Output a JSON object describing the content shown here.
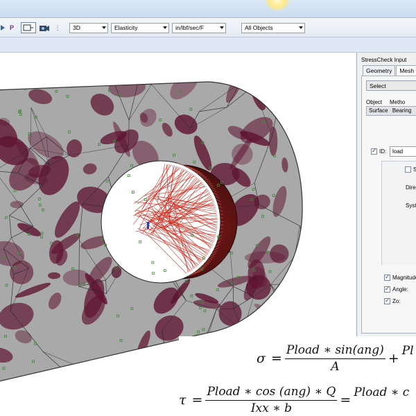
{
  "toolbar": {
    "combos": [
      {
        "value": "3D"
      },
      {
        "value": "Elasticity"
      },
      {
        "value": "in/lbf/sec/F"
      },
      {
        "value": "All Objects"
      }
    ],
    "icons": [
      "arrow-icon",
      "pointer-p-icon",
      "window-select-icon",
      "camera-icon"
    ],
    "p_label": "P"
  },
  "panel": {
    "title": "StressCheck Input",
    "tabs": [
      "Geometry",
      "Mesh"
    ],
    "action_select": "Select",
    "object_label": "Object",
    "method_label": "Metho",
    "object_value": "Surface",
    "method_value": "Bearing",
    "id_label": "ID:",
    "id_value": "load",
    "s_label": "S",
    "direction_label": "Direc",
    "system_label": "Syste",
    "magnitude_label": "Magnitude",
    "angle_label": "Angle:",
    "zo_label": "Zo:"
  },
  "formula": {
    "eq1": {
      "lhs": "σ",
      "eq": "=",
      "num": "Pload ∗ sin(ang)",
      "den": "A",
      "plus": "+",
      "tail": "Pl"
    },
    "eq2": {
      "lhs": "τ",
      "eq": "=",
      "num": "Pload ∗ cos (ang) ∗ Q",
      "den": "Ixx ∗ b",
      "eq_b": "=",
      "tail": "Pload ∗ c"
    }
  },
  "colors": {
    "mesh_gray": "#a9a9a9",
    "stress_maroon": "#5e1330",
    "load_red": "#cc2a1d",
    "node_green": "#3f8a3a"
  }
}
